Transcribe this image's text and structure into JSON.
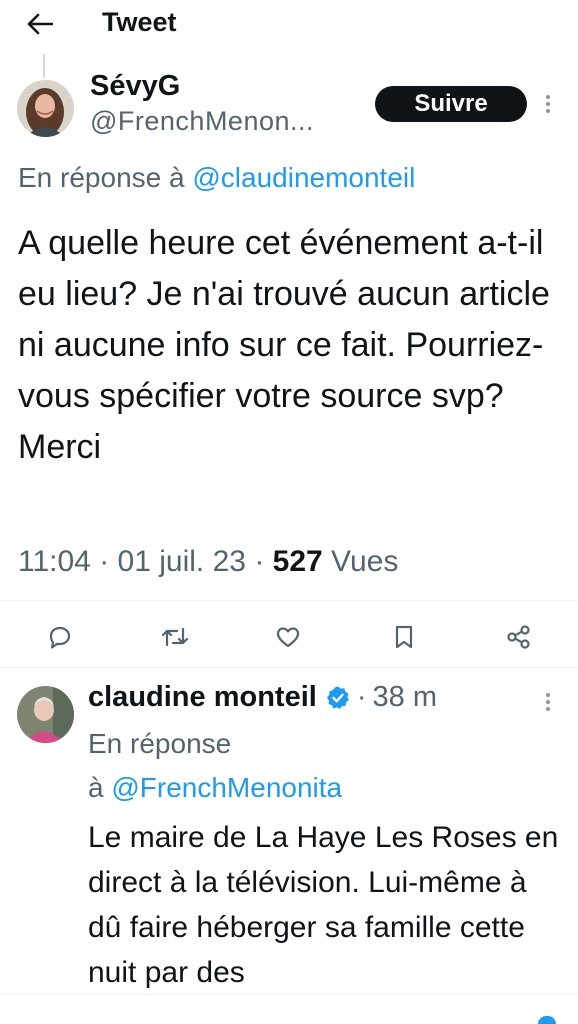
{
  "header": {
    "title": "Tweet",
    "back_icon": "arrow-left-icon"
  },
  "tweet": {
    "author_name": "SévyG",
    "author_handle": "@FrenchMenon...",
    "follow_label": "Suivre",
    "reply_prefix": "En réponse à",
    "reply_mention": "@claudinemonteil",
    "text": "A quelle heure cet événement a-t-il eu lieu? Je n'ai trouvé aucun article ni aucune info sur ce fait. Pourriez-vous spécifier votre source svp? Merci",
    "time": "11:04",
    "date": "01 juil. 23",
    "views_count": "527",
    "views_label": "Vues",
    "actions": [
      "reply-icon",
      "retweet-icon",
      "like-icon",
      "bookmark-icon",
      "share-icon"
    ]
  },
  "reply": {
    "author_name": "claudine monteil",
    "verified": true,
    "separator": "·",
    "time_ago": "38 m",
    "reply_prefix_line1": "En réponse",
    "reply_prefix_line2": "à",
    "reply_mention": "@FrenchMenonita",
    "text": "Le maire de La Haye Les Roses en direct à la télévision. Lui-même à dû faire héberger sa famille cette nuit par des"
  },
  "colors": {
    "text_primary": "#0f1419",
    "text_secondary": "#536471",
    "accent": "#1d9bf0",
    "divider": "#eff3f4",
    "follow_bg": "#0f1419"
  }
}
